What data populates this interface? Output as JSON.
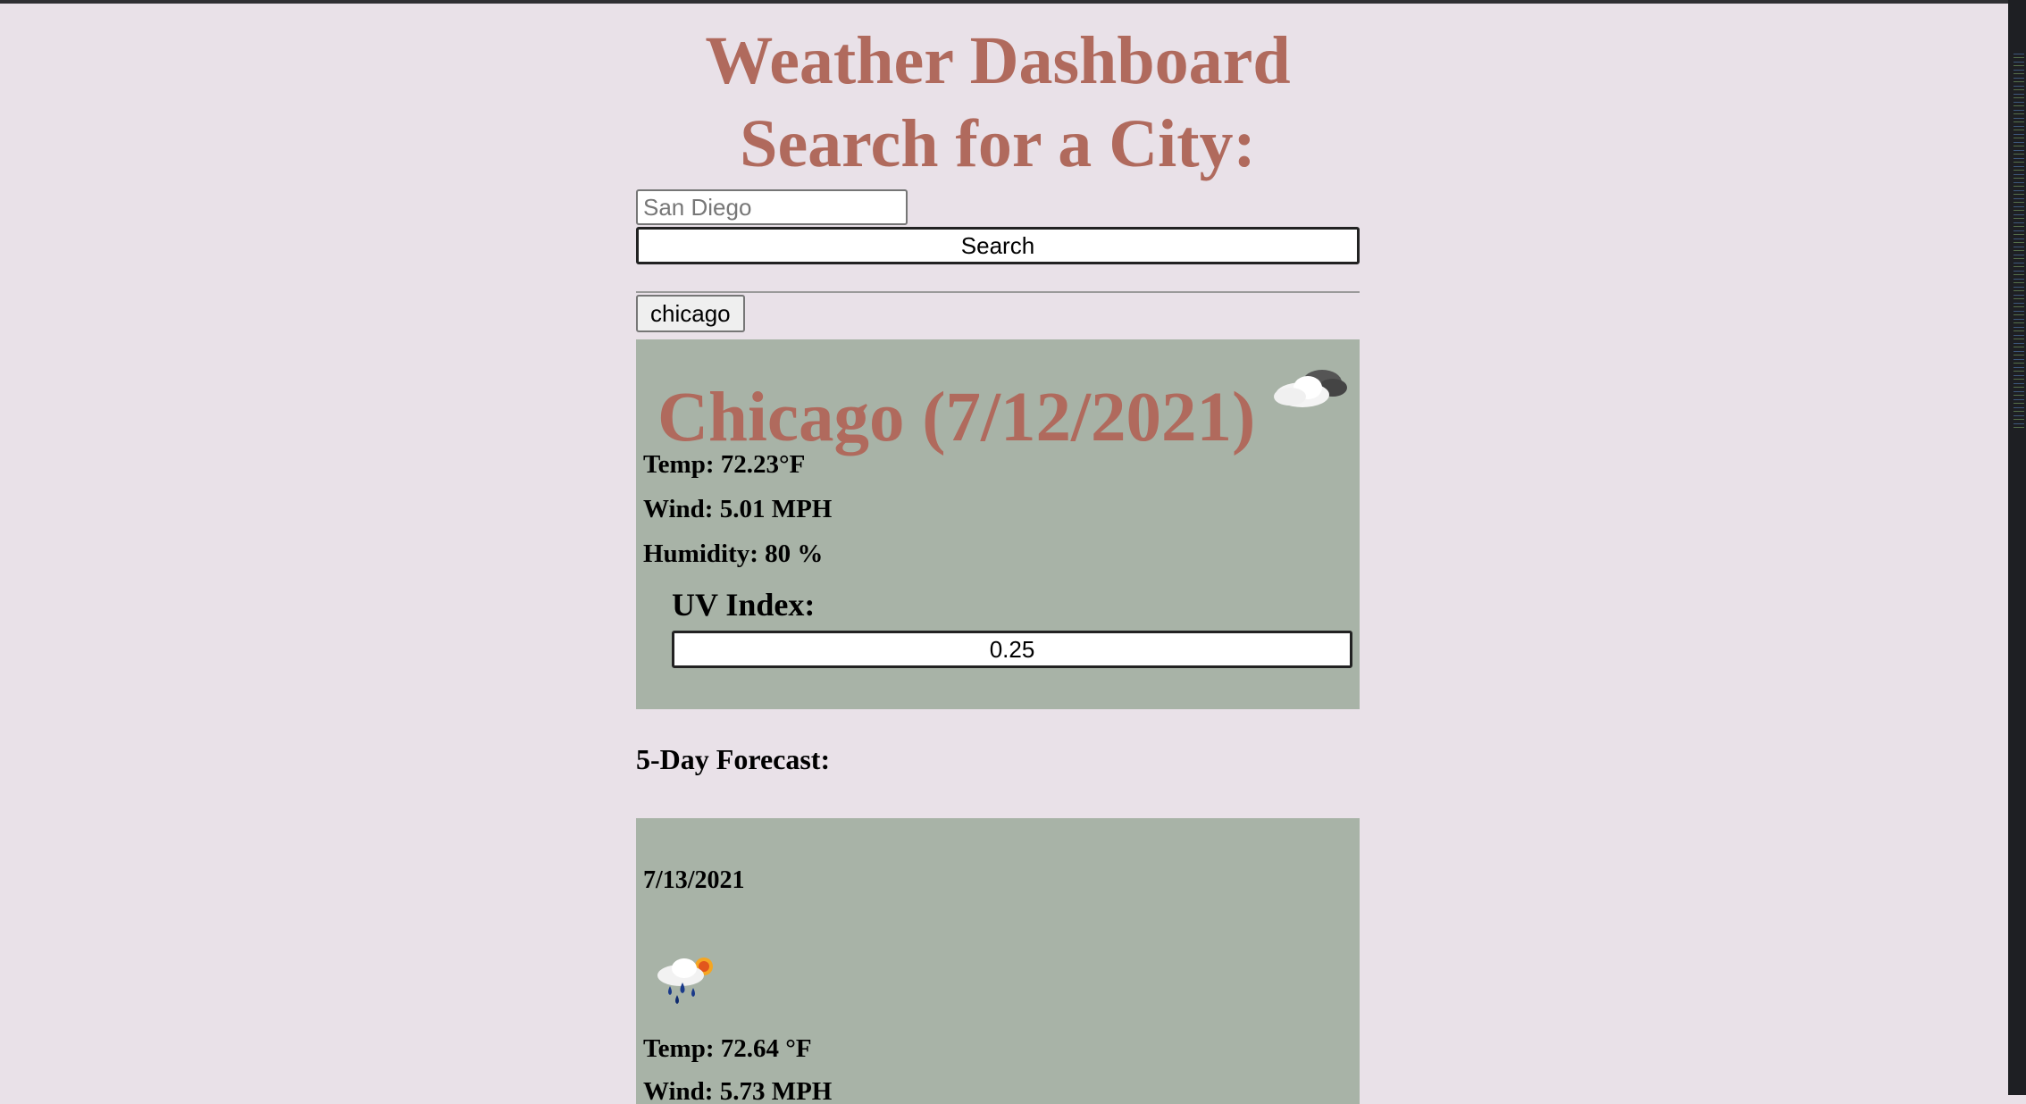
{
  "header": {
    "title_line1": "Weather Dashboard",
    "title_line2": "Search for a City:"
  },
  "search": {
    "placeholder": "San Diego",
    "value": "",
    "button_label": "Search"
  },
  "history": {
    "items": [
      "chicago"
    ]
  },
  "current": {
    "heading": "Chicago (7/12/2021)",
    "icon": "cloudy-icon",
    "temp": "Temp: 72.23°F",
    "wind": "Wind: 5.01 MPH",
    "humidity": "Humidity: 80 %",
    "uv_label": "UV Index:",
    "uv_value": "0.25"
  },
  "forecast": {
    "heading": "5-Day Forecast:",
    "days": [
      {
        "date": "7/13/2021",
        "icon": "rain-sun-icon",
        "temp": "Temp: 72.64 °F",
        "wind": "Wind: 5.73 MPH"
      }
    ]
  },
  "colors": {
    "background": "#e9e1e8",
    "title": "#b06a5d",
    "card": "#a8b3a7"
  }
}
